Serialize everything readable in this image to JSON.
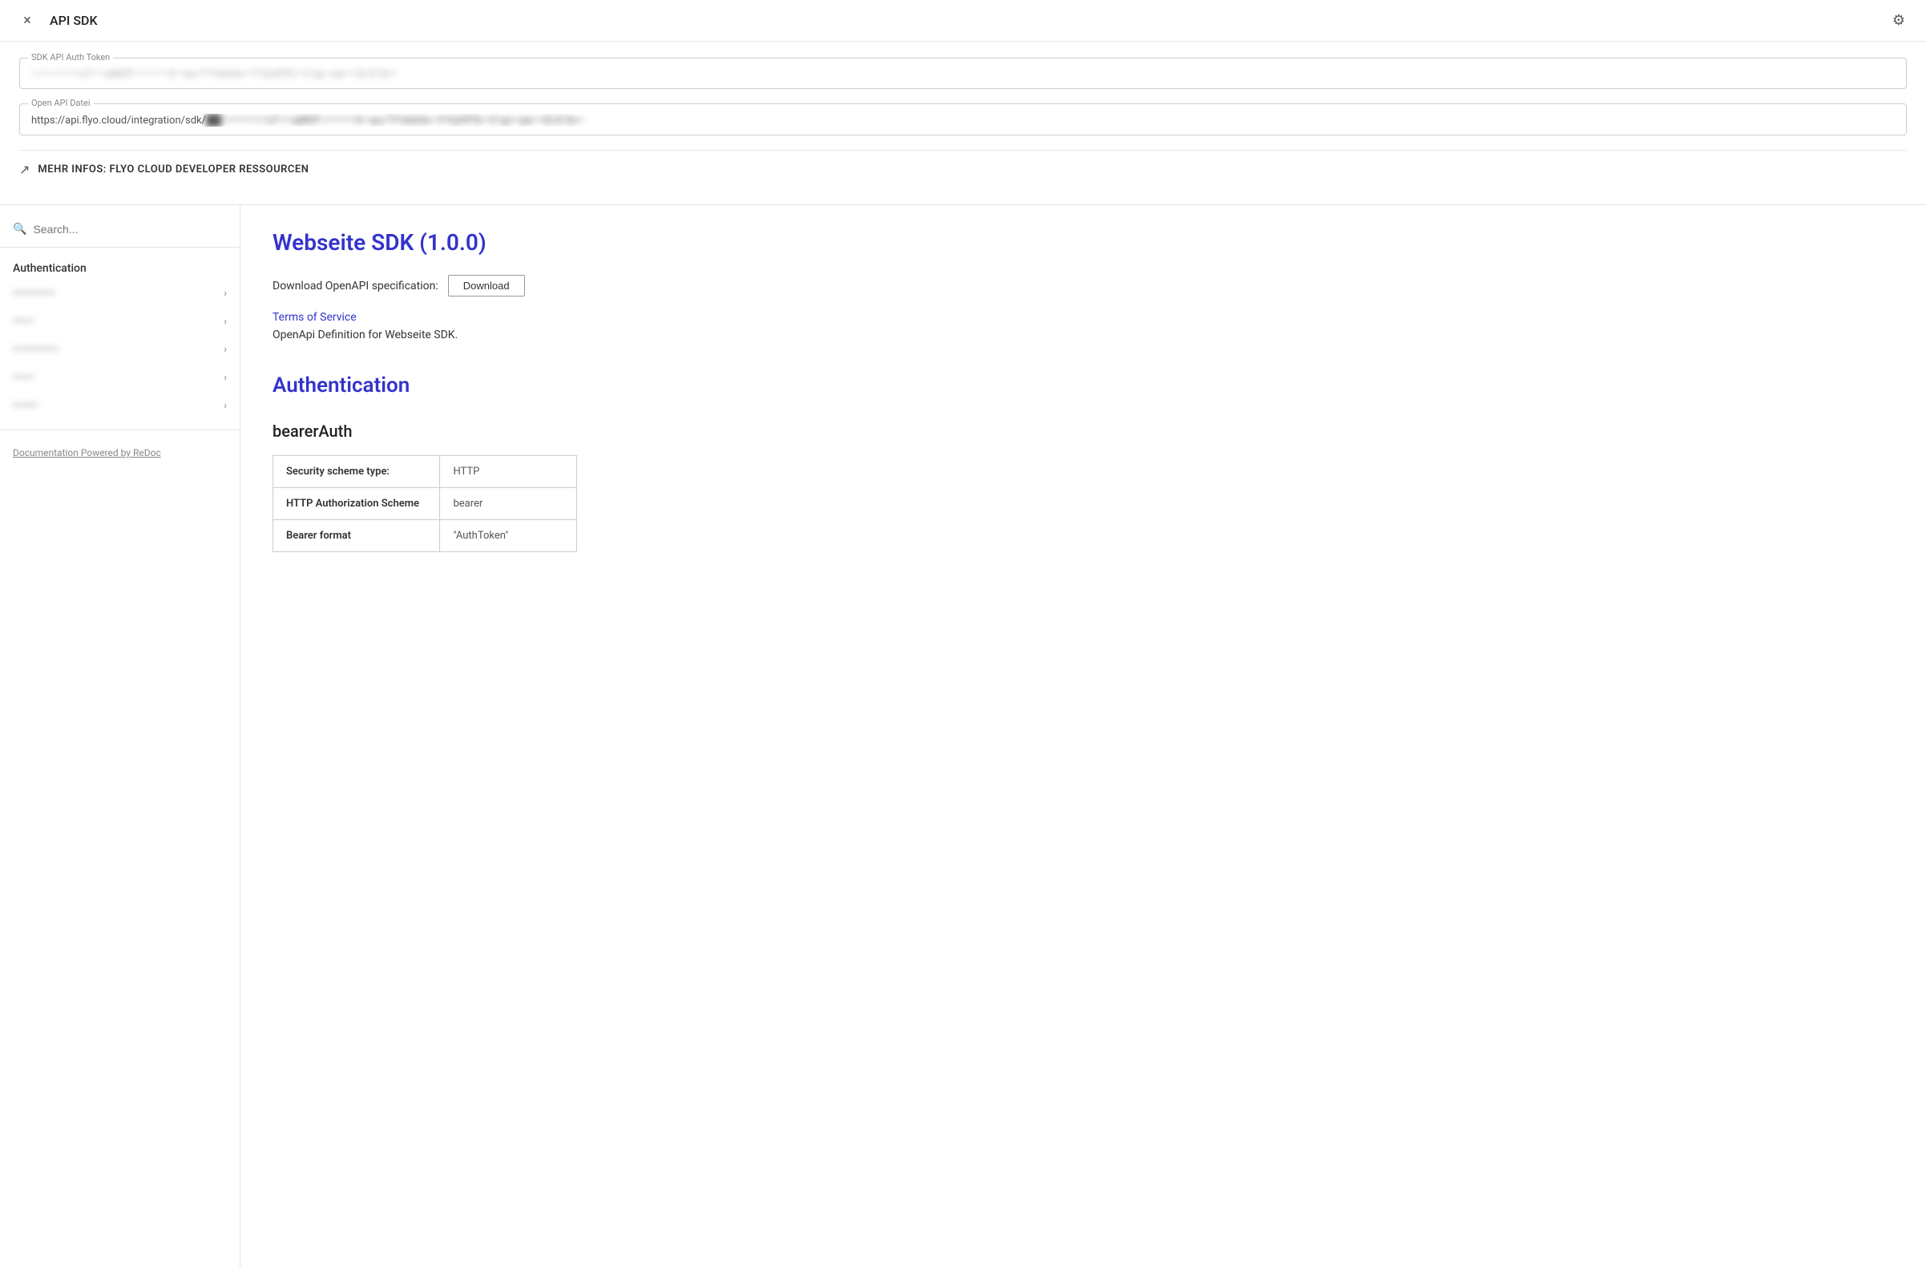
{
  "titleBar": {
    "close_label": "×",
    "title": "API SDK",
    "gear_label": "⚙"
  },
  "sdkApiAuthToken": {
    "label": "SDK API Auth Token",
    "value": "••••••••••••••LF••••qMDF••••••••••3•••pu•TY•b6Uls•••f•VyHFPj•••C•pj•••pe•••OLX•3n••"
  },
  "openApiDatei": {
    "label": "Open API Datei",
    "url_prefix": "https://api.flyo.cloud/integration/sdk/",
    "url_blurred": "██/••••••••••••LF••••qMDF••••••••••3•••pu•TY•b6Uls•••f•VyHFPj•••C•pj•••pe•••OLX•3n••"
  },
  "externalLink": {
    "text": "MEHR INFOS: FLYO CLOUD DEVELOPER RESSOURCEN"
  },
  "search": {
    "placeholder": "Search..."
  },
  "sidebar": {
    "sectionLabel": "Authentication",
    "items": [
      {
        "label": "••••••••••••"
      },
      {
        "label": "••••••"
      },
      {
        "label": "•••••••••••••"
      },
      {
        "label": "••••••"
      },
      {
        "label": "•••••••"
      }
    ],
    "footerLink": "Documentation Powered by ReDoc"
  },
  "doc": {
    "title": "Webseite SDK (1.0.0)",
    "downloadLabel": "Download OpenAPI specification:",
    "downloadButton": "Download",
    "termsLink": "Terms of Service",
    "openApiDesc": "OpenApi Definition for Webseite SDK.",
    "authSection": "Authentication",
    "bearerAuth": "bearerAuth",
    "table": {
      "rows": [
        {
          "key": "Security scheme type:",
          "value": "HTTP"
        },
        {
          "key": "HTTP Authorization Scheme",
          "value": "bearer"
        },
        {
          "key": "Bearer format",
          "value": "\"AuthToken\""
        }
      ]
    }
  }
}
